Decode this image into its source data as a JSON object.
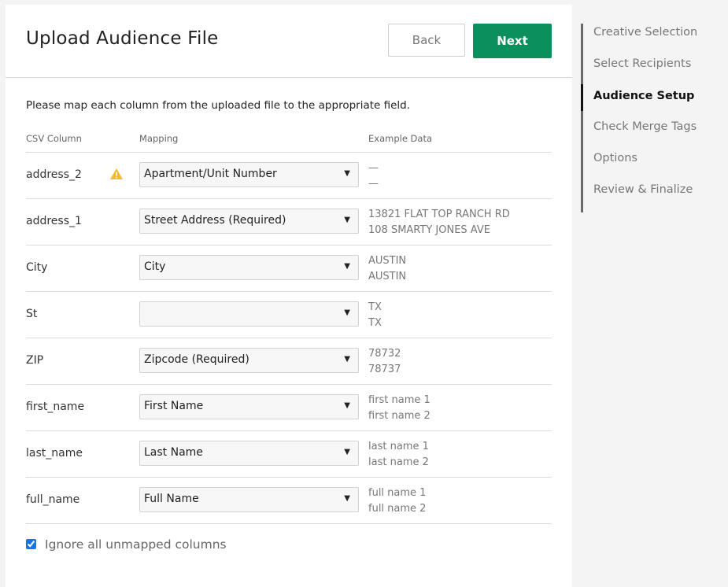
{
  "header": {
    "title": "Upload Audience File",
    "back_label": "Back",
    "next_label": "Next"
  },
  "instructions": "Please map each column from the uploaded file to the appropriate field.",
  "table": {
    "headers": {
      "csv_column": "CSV Column",
      "mapping": "Mapping",
      "example_data": "Example Data"
    },
    "rows": [
      {
        "csv": "address_2",
        "mapping": "Apartment/Unit Number",
        "example": [
          "—",
          "—"
        ],
        "warning": true
      },
      {
        "csv": "address_1",
        "mapping": "Street Address (Required)",
        "example": [
          "13821 FLAT TOP RANCH RD",
          "108 SMARTY JONES AVE"
        ]
      },
      {
        "csv": "City",
        "mapping": "City",
        "example": [
          "AUSTIN",
          "AUSTIN"
        ]
      },
      {
        "csv": "St",
        "mapping": "",
        "example": [
          "TX",
          "TX"
        ]
      },
      {
        "csv": "ZIP",
        "mapping": "Zipcode (Required)",
        "example": [
          "78732",
          "78737"
        ]
      },
      {
        "csv": "first_name",
        "mapping": "First Name",
        "example": [
          "first name 1",
          "first name 2"
        ]
      },
      {
        "csv": "last_name",
        "mapping": "Last Name",
        "example": [
          "last name 1",
          "last name 2"
        ]
      },
      {
        "csv": "full_name",
        "mapping": "Full Name",
        "example": [
          "full name 1",
          "full name 2"
        ]
      }
    ]
  },
  "ignore_unmapped": {
    "label": "Ignore all unmapped columns",
    "checked": true
  },
  "steps": {
    "items": [
      "Creative Selection",
      "Select Recipients",
      "Audience Setup",
      "Check Merge Tags",
      "Options",
      "Review & Finalize"
    ],
    "active_index": 2
  },
  "colors": {
    "accent": "#0b8f5c",
    "warning": "#f5b82e",
    "checkbox": "#1a73e8"
  },
  "icons": {
    "warning": "warning-triangle-icon",
    "caret": "caret-down-icon"
  }
}
